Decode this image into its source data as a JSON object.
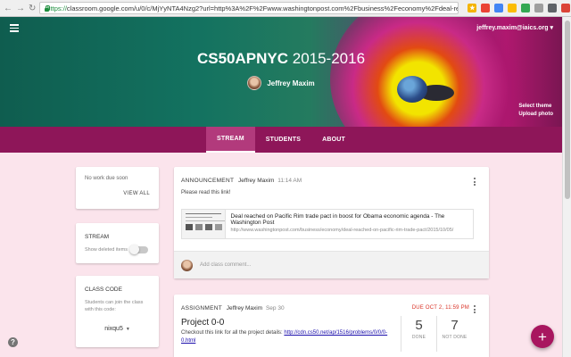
{
  "browser": {
    "url_scheme": "https://",
    "url_rest": "classroom.google.com/u/0/c/MjYyNTA4Nzg2?url=http%3A%2F%2Fwww.washingtonpost.com%2Fbusiness%2Feconomy%2Fdeal-reached-on-pac..."
  },
  "header": {
    "account": "jeffrey.maxim@iaics.org",
    "class_name": "CS50APNYC",
    "class_year": "2015-2016",
    "teacher": "Jeffrey Maxim",
    "select_theme": "Select theme",
    "upload_photo": "Upload photo"
  },
  "tabs": [
    {
      "label": "STREAM",
      "active": true
    },
    {
      "label": "STUDENTS",
      "active": false
    },
    {
      "label": "ABOUT",
      "active": false
    }
  ],
  "sidebar": {
    "due": {
      "text": "No work due soon",
      "view_all": "VIEW ALL"
    },
    "stream": {
      "heading": "STREAM",
      "show_deleted": "Show deleted items"
    },
    "class_code": {
      "heading": "CLASS CODE",
      "help": "Students can join the class with this code:",
      "code": "nixqu5"
    }
  },
  "announcement": {
    "kind": "ANNOUNCEMENT",
    "author": "Jeffrey Maxim",
    "time": "11:14 AM",
    "body": "Please read this link!",
    "link_title": "Deal reached on Pacific Rim trade pact in boost for Obama economic agenda - The Washington Post",
    "link_url": "http://www.washingtonpost.com/business/economy/deal-reached-on-pacific-rim-trade-pact/2015/10/05/",
    "comment_placeholder": "Add class comment..."
  },
  "assignment": {
    "kind": "ASSIGNMENT",
    "author": "Jeffrey Maxim",
    "date": "Sep 30",
    "due": "DUE OCT 2, 11:59 PM",
    "title": "Project 0-0",
    "desc_prefix": "Checkout this link for all the project details:",
    "desc_link": "http://cdn.cs50.net/ap/1516/problems/0/0/0-0.html",
    "done_count": "5",
    "done_label": "DONE",
    "not_done_count": "7",
    "not_done_label": "NOT DONE"
  },
  "fab": {
    "label": "+"
  },
  "help": {
    "label": "?"
  },
  "icons": {
    "menu": "hamburger-menu-icon",
    "more": "more-vert-icon",
    "add": "add-icon",
    "help": "help-icon",
    "lock": "lock-icon"
  },
  "colors": {
    "accent": "#8e1659",
    "fab": "#a8165f",
    "page_bg": "#fbe4ec",
    "due_red": "#d93025"
  }
}
